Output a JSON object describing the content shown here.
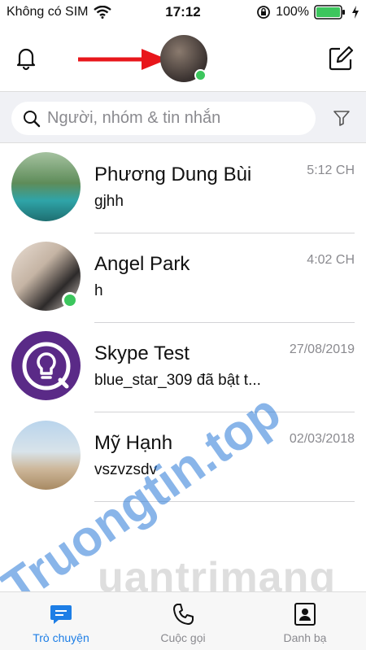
{
  "status_bar": {
    "carrier": "Không có SIM",
    "time": "17:12",
    "battery": "100%"
  },
  "search": {
    "placeholder": "Người, nhóm & tin nhắn"
  },
  "conversations": [
    {
      "name": "Phương Dung Bùi",
      "message": "gjhh",
      "time": "5:12 CH",
      "online": false
    },
    {
      "name": "Angel Park",
      "message": "h",
      "time": "4:02 CH",
      "online": true
    },
    {
      "name": "Skype Test",
      "message": "blue_star_309 đã bật t...",
      "time": "27/08/2019",
      "online": false
    },
    {
      "name": "Mỹ Hạnh",
      "message": "vszvzsdv",
      "time": "02/03/2018",
      "online": false
    }
  ],
  "tabs": [
    {
      "label": "Trò chuyện",
      "active": true
    },
    {
      "label": "Cuộc gọi",
      "active": false
    },
    {
      "label": "Danh bạ",
      "active": false
    }
  ],
  "watermark": {
    "primary": "Truongtin.top",
    "secondary": "uantrimang"
  },
  "colors": {
    "accent": "#1d7ee6",
    "online": "#3cc65d",
    "arrow": "#e8161b",
    "skype_purple": "#5a2a87"
  }
}
